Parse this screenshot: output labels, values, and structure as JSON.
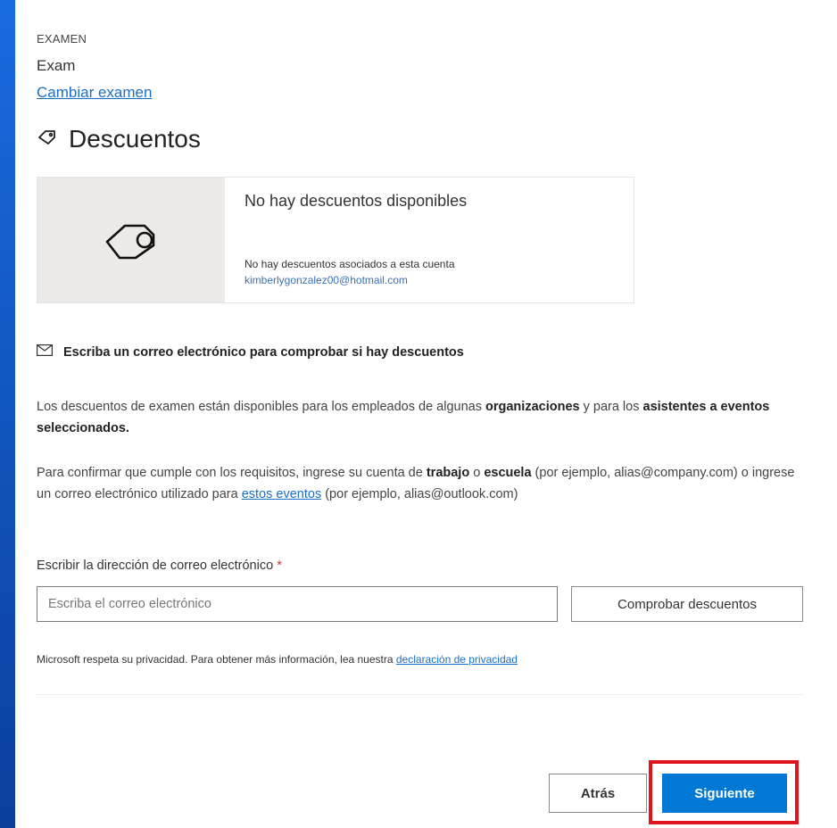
{
  "exam": {
    "label": "EXAMEN",
    "name": "Exam",
    "change_link": "Cambiar examen"
  },
  "discounts": {
    "title": "Descuentos",
    "icon": "tag-icon",
    "card": {
      "title": "No hay descuentos disponibles",
      "subtitle": "No hay descuentos asociados a esta cuenta",
      "email": "kimberlygonzalez00@hotmail.com"
    }
  },
  "email_check": {
    "icon": "mail-icon",
    "heading": "Escriba un correo electrónico para comprobar si hay descuentos",
    "para1": {
      "t1": "Los descuentos de examen están disponibles para los empleados de algunas ",
      "b1": "organizaciones",
      "t2": " y para los ",
      "b2": "asistentes a eventos seleccionados."
    },
    "para2": {
      "t1": "Para confirmar que cumple con los requisitos, ingrese su cuenta de ",
      "b1": "trabajo",
      "t2": " o ",
      "b2": "escuela",
      "t3": " (por ejemplo, alias@company.com) o ingrese un correo electrónico utilizado para ",
      "link": "estos eventos",
      "t4": " (por ejemplo, alias@outlook.com)"
    },
    "field_label": "Escribir la dirección de correo electrónico",
    "required_mark": "*",
    "placeholder": "Escriba el correo electrónico",
    "check_button": "Comprobar descuentos",
    "privacy_text": "Microsoft respeta su privacidad. Para obtener más información, lea nuestra ",
    "privacy_link": "declaración de privacidad"
  },
  "footer": {
    "back": "Atrás",
    "next": "Siguiente"
  },
  "colors": {
    "accent": "#0078d4",
    "link": "#1a6fc7",
    "highlight": "#e0141e",
    "background": "#0b4fb8"
  }
}
